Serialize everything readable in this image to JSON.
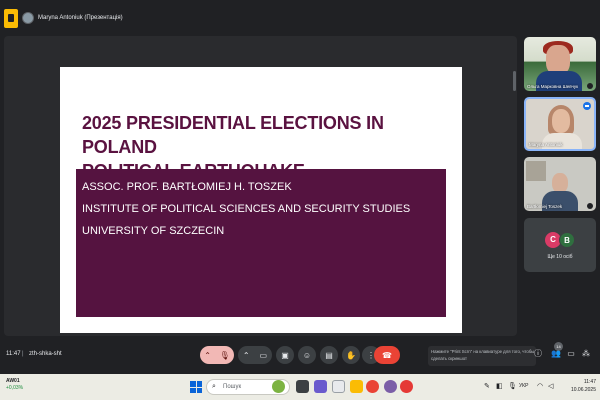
{
  "header": {
    "presenter_label": "Maryna Antoniuk (Презентація)"
  },
  "slide": {
    "title_line1": "2025 PRESIDENTIAL ELECTIONS IN POLAND",
    "title_line2": "POLITICAL EARTHQUAKE",
    "author": "ASSOC. PROF. BARTŁOMIEJ H. TOSZEK",
    "institute": "INSTITUTE OF POLITICAL SCIENCES AND SECURITY STUDIES",
    "university": "UNIVERSITY OF SZCZECIN",
    "title_color": "#5a1240",
    "box_color": "#551340"
  },
  "participants": [
    {
      "name": "Ольга Марковна Шевчук"
    },
    {
      "name": "Maryna Antoniuk"
    },
    {
      "name": "Bartłomiej Toszek"
    }
  ],
  "more_participants": {
    "initials": [
      "C",
      "B"
    ],
    "label": "Ще 10 осіб"
  },
  "controls": {
    "time": "11:47",
    "separator": "|",
    "meeting_code": "zth-shka-sht",
    "hangup_color": "#ea4335",
    "toast_line1": "Нажмите \"Print Scrn\" на клавиатуре для того, чтобы",
    "toast_line2": "сделать скриншот",
    "participants_badge": "14"
  },
  "taskbar": {
    "index_name": "AW01",
    "index_change": "+0,03%",
    "search_label": "Пошук",
    "language": "УКР",
    "time": "11:47",
    "date": "10.06.2025"
  }
}
